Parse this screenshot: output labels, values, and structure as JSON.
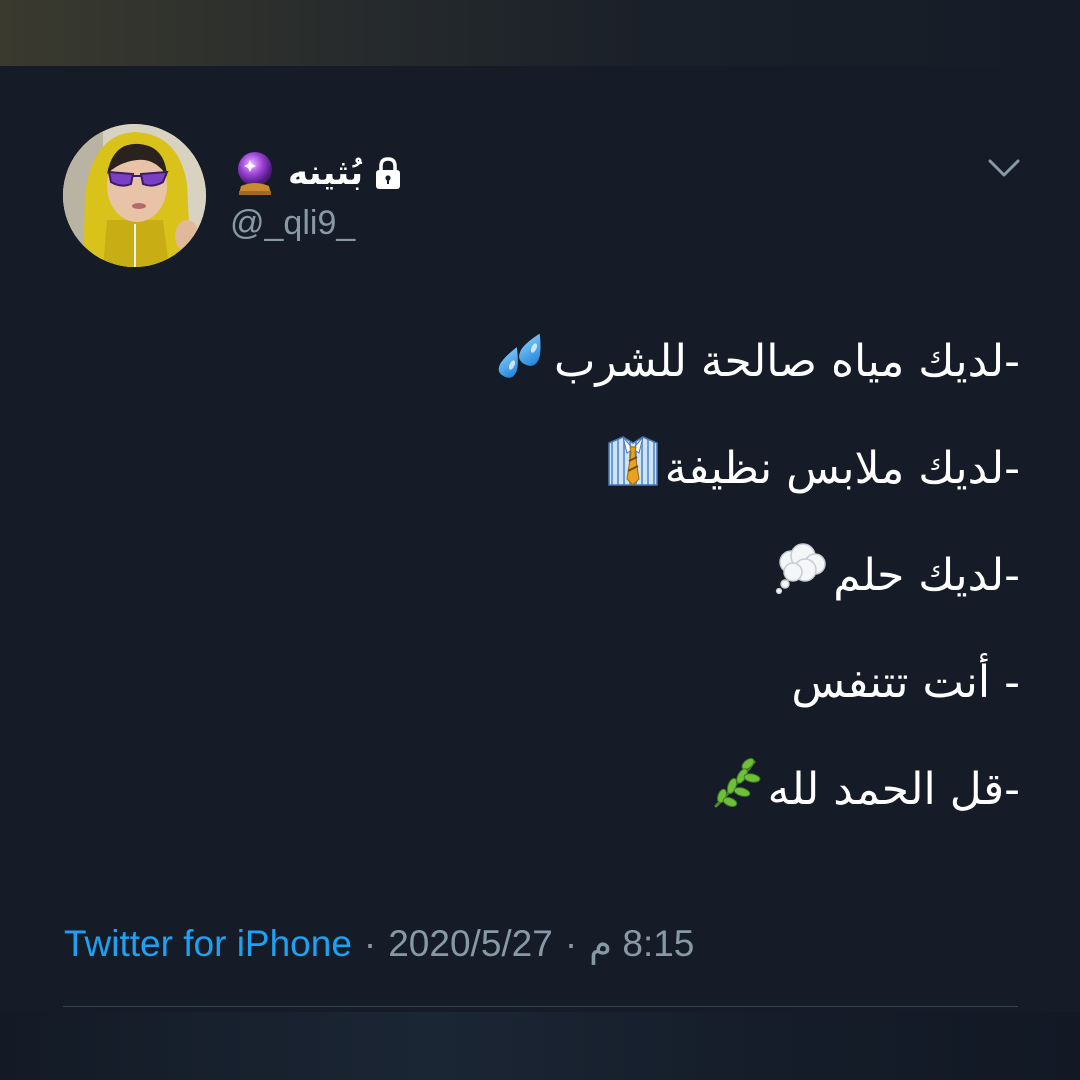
{
  "user": {
    "display_name": "بُثينه",
    "handle": "@_qli9_",
    "protected": true,
    "name_emoji": "crystal-ball-icon"
  },
  "tweet": {
    "lines": [
      {
        "text": "-لديك مياه صالحة للشرب",
        "emoji": "sweat-droplets-icon"
      },
      {
        "text": "-لديك ملابس نظيفة",
        "emoji": "shirt-tie-icon"
      },
      {
        "text": "-لديك حلم",
        "emoji": "thought-balloon-icon"
      },
      {
        "text": "- أنت تتنفس",
        "emoji": ""
      },
      {
        "text": "-قل الحمد لله",
        "emoji": "herb-icon"
      }
    ]
  },
  "meta": {
    "time": "8:15 م",
    "separator": "·",
    "date": "2020/5/27",
    "source": "Twitter for iPhone"
  },
  "colors": {
    "background": "#151c28",
    "text": "#ffffff",
    "secondary": "#8899a6",
    "link": "#1da1f2",
    "divider": "#38444d"
  }
}
